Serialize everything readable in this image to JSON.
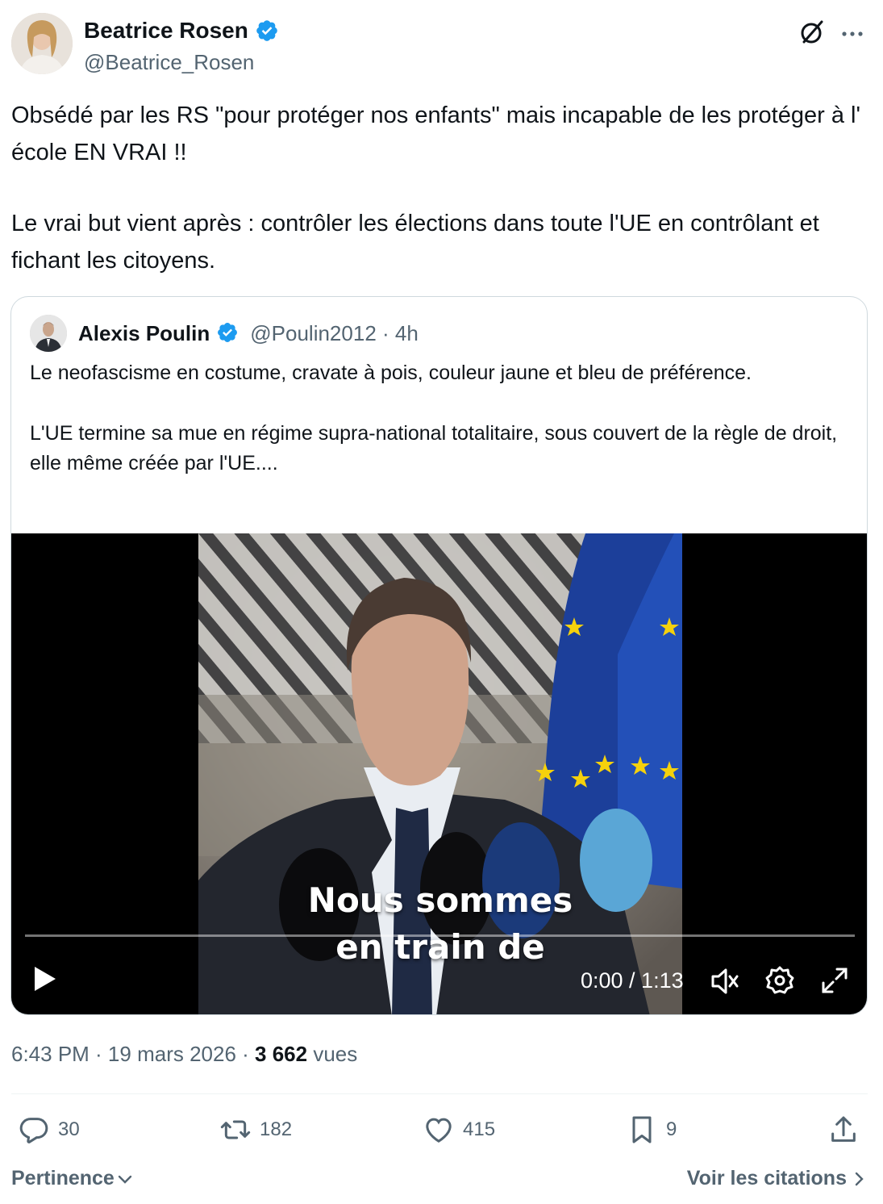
{
  "author": {
    "name": "Beatrice Rosen",
    "handle": "@Beatrice_Rosen"
  },
  "tweet": {
    "paragraph1": "Obsédé par les RS \"pour protéger nos enfants\" mais incapable de les protéger à l' école EN VRAI !!",
    "paragraph2": "Le vrai but vient après : contrôler les élections dans toute l'UE en contrôlant et fichant les citoyens."
  },
  "quote": {
    "name": "Alexis Poulin",
    "handle": "@Poulin2012 · 4h",
    "paragraph1": "Le neofascisme en costume, cravate à pois, couleur jaune et bleu de préférence.",
    "paragraph2": "L'UE termine sa mue en régime supra-national totalitaire, sous couvert de la règle de droit, elle même créée par l'UE...."
  },
  "video": {
    "caption_line1": "Nous sommes",
    "caption_line2": "en train de",
    "time": "0:00 / 1:13",
    "progress": 0
  },
  "meta": {
    "time_date": "6:43 PM · 19 mars 2026 · ",
    "views_count": "3 662",
    "views_label": " vues"
  },
  "actions": {
    "replies": "30",
    "reposts": "182",
    "likes": "415",
    "bookmarks": "9"
  },
  "footer": {
    "sort_label": "Pertinence",
    "citations_label": "Voir les citations"
  },
  "colors": {
    "text": "#0f1419",
    "secondary": "#536471",
    "verified": "#1d9bf0",
    "border": "#cfd9de"
  },
  "icons": [
    "verified-badge-icon",
    "grok-icon",
    "more-icon",
    "play-icon",
    "volume-icon",
    "settings-icon",
    "fullscreen-icon",
    "reply-icon",
    "repost-icon",
    "like-icon",
    "bookmark-icon",
    "share-icon",
    "chevron-down-icon",
    "chevron-right-icon"
  ]
}
